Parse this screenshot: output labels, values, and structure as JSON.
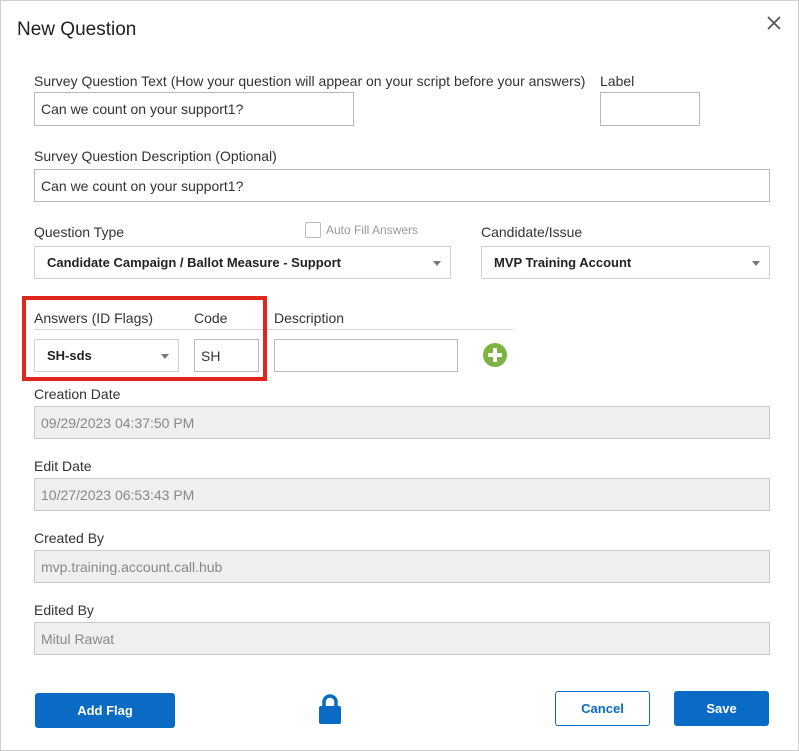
{
  "dialog": {
    "title": "New Question"
  },
  "question_text": {
    "label": "Survey Question Text (How your question will appear on your script before your answers)",
    "value": "Can we count on your support1?"
  },
  "label_field": {
    "label": "Label",
    "value": ""
  },
  "description_field": {
    "label": "Survey Question Description (Optional)",
    "value": "Can we count on your support1?"
  },
  "question_type": {
    "label": "Question Type",
    "value": "Candidate Campaign / Ballot Measure - Support"
  },
  "auto_fill": {
    "label": "Auto Fill Answers",
    "checked": false
  },
  "candidate_issue": {
    "label": "Candidate/Issue",
    "value": "MVP Training Account"
  },
  "answers": {
    "label": "Answers (ID Flags)",
    "code_label": "Code",
    "description_label": "Description",
    "flag_value": "SH-sds",
    "code_value": "SH",
    "description_value": ""
  },
  "creation_date": {
    "label": "Creation Date",
    "value": "09/29/2023 04:37:50 PM"
  },
  "edit_date": {
    "label": "Edit Date",
    "value": "10/27/2023 06:53:43 PM"
  },
  "created_by": {
    "label": "Created By",
    "value": "mvp.training.account.call.hub"
  },
  "edited_by": {
    "label": "Edited By",
    "value": "Mitul Rawat"
  },
  "buttons": {
    "add_flag": "Add Flag",
    "cancel": "Cancel",
    "save": "Save"
  },
  "colors": {
    "primary": "#0a6bc4",
    "add": "#7cb342",
    "highlight": "#e0261c"
  }
}
